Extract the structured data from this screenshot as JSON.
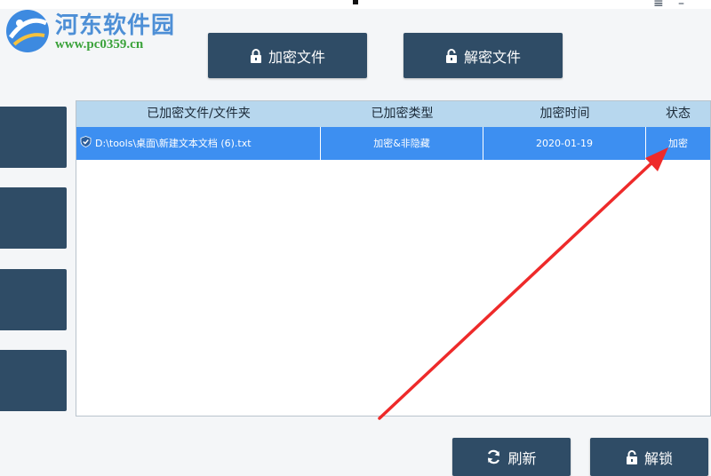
{
  "watermark": {
    "title": "河东软件园",
    "url": "www.pc0359.cn"
  },
  "window": {
    "menu_icon": "menu-icon",
    "minimize_icon": "minimize-icon"
  },
  "toolbar": {
    "encrypt_label": "加密文件",
    "decrypt_label": "解密文件"
  },
  "table": {
    "columns": [
      "已加密文件/文件夹",
      "已加密类型",
      "加密时间",
      "状态"
    ],
    "rows": [
      {
        "path": "D:\\tools\\桌面\\新建文本文档 (6).txt",
        "type": "加密&非隐藏",
        "time": "2020-01-19",
        "status": "加密"
      }
    ]
  },
  "footer": {
    "refresh_label": "刷新",
    "unlock_label": "解锁"
  },
  "colors": {
    "button_bg": "#2f4c66",
    "header_bg": "#b7d7ee",
    "row_selected": "#3d8ff1",
    "arrow": "#ee2a2a"
  }
}
